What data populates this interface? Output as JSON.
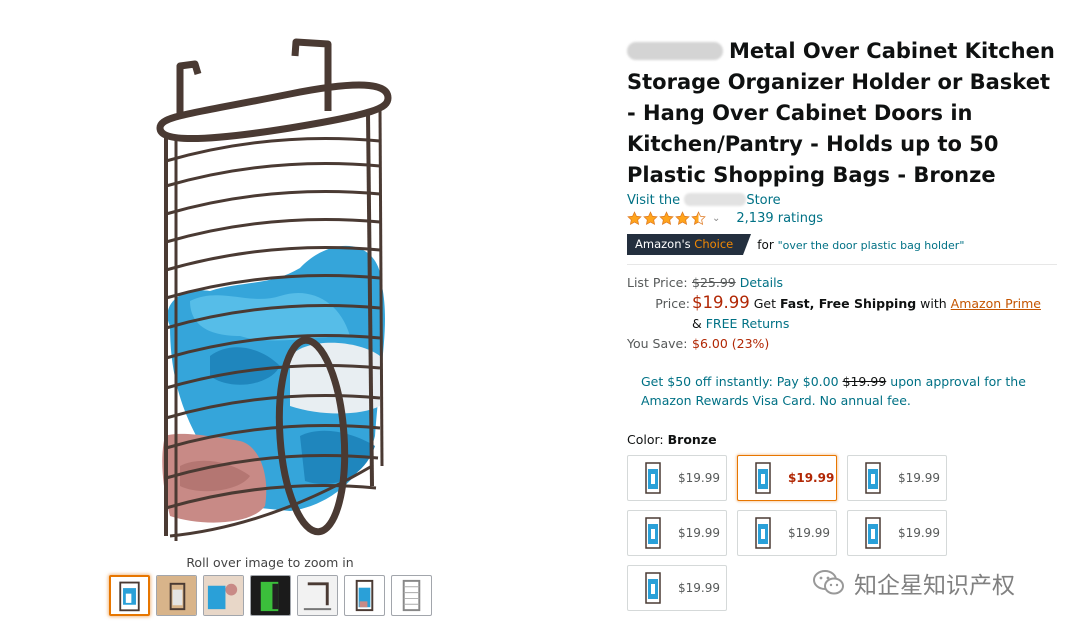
{
  "gallery": {
    "zoom_hint": "Roll over image to zoom in",
    "thumb_count": 7
  },
  "product": {
    "title": "Metal Over Cabinet Kitchen Storage Organizer Holder or Basket - Hang Over Cabinet Doors in Kitchen/Pantry - Holds up to 50 Plastic Shopping Bags - Bronze",
    "store_prefix": "Visit the",
    "store_suffix": "Store",
    "rating_stars": 4.5,
    "ratings_count": "2,139 ratings",
    "choice_badge_a": "Amazon's",
    "choice_badge_b": "Choice",
    "choice_for": "for",
    "choice_keyword": "\"over the door plastic bag holder\""
  },
  "pricing": {
    "list_price_label": "List Price:",
    "list_price": "$25.99",
    "details_link": "Details",
    "price_label": "Price:",
    "price": "$19.99",
    "ship_get": "Get",
    "ship_fast": "Fast, Free Shipping",
    "ship_with": "with",
    "prime_link": "Amazon Prime",
    "free_returns_amp": "&",
    "free_returns": "FREE Returns",
    "save_label": "You Save:",
    "save_value": "$6.00 (23%)"
  },
  "promo": {
    "line_a": "Get $50 off instantly: Pay $0.00",
    "strike": "$19.99",
    "line_b": "upon approval for the Amazon Rewards Visa Card. No annual fee."
  },
  "color": {
    "label": "Color:",
    "value": "Bronze",
    "options": [
      {
        "price": "$19.99",
        "selected": false
      },
      {
        "price": "$19.99",
        "selected": true
      },
      {
        "price": "$19.99",
        "selected": false
      },
      {
        "price": "$19.99",
        "selected": false
      },
      {
        "price": "$19.99",
        "selected": false
      },
      {
        "price": "$19.99",
        "selected": false
      },
      {
        "price": "$19.99",
        "selected": false
      }
    ]
  },
  "watermark": {
    "text": "知企星知识产权"
  },
  "colors": {
    "link": "#007185",
    "price_red": "#b12704",
    "badge_bg": "#232f3e",
    "badge_orange": "#f08804",
    "star": "#ffa41c",
    "selected_border": "#e77600",
    "bronze": "#4a3a33",
    "bag_blue": "#2aa0d8",
    "bag_pink": "#c88a86"
  }
}
